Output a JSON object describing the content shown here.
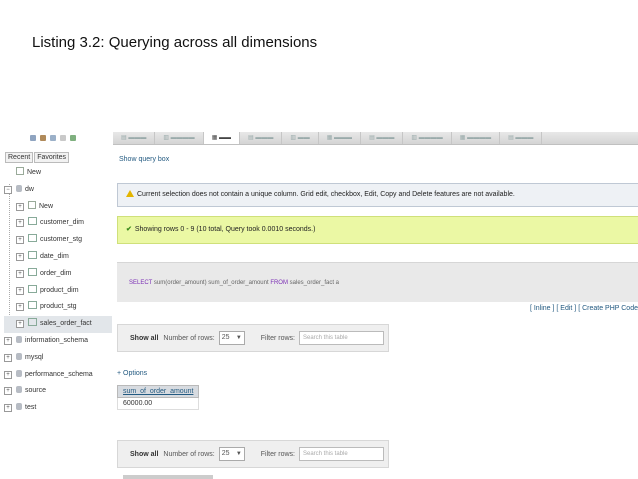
{
  "slide": {
    "title": "Listing 3.2: Querying across all dimensions"
  },
  "nav": {
    "tabs": [
      "Recent",
      "Favorites"
    ],
    "tree": [
      {
        "label": "New",
        "level": 0,
        "icon": "new-icon"
      },
      {
        "label": "dw",
        "level": 0,
        "icon": "database-icon"
      },
      {
        "label": "New",
        "level": 1,
        "icon": "new-icon"
      },
      {
        "label": "customer_dim",
        "level": 1,
        "icon": "table-icon"
      },
      {
        "label": "customer_stg",
        "level": 1,
        "icon": "table-icon"
      },
      {
        "label": "date_dim",
        "level": 1,
        "icon": "table-icon"
      },
      {
        "label": "order_dim",
        "level": 1,
        "icon": "table-icon"
      },
      {
        "label": "product_dim",
        "level": 1,
        "icon": "table-icon"
      },
      {
        "label": "product_stg",
        "level": 1,
        "icon": "table-icon"
      },
      {
        "label": "sales_order_fact",
        "level": 1,
        "icon": "table-icon",
        "selected": true
      },
      {
        "label": "information_schema",
        "level": 0,
        "icon": "database-icon"
      },
      {
        "label": "mysql",
        "level": 0,
        "icon": "database-icon"
      },
      {
        "label": "performance_schema",
        "level": 0,
        "icon": "database-icon"
      },
      {
        "label": "source",
        "level": 0,
        "icon": "database-icon"
      },
      {
        "label": "test",
        "level": 0,
        "icon": "database-icon"
      }
    ]
  },
  "main": {
    "show_query_box": "Show query box",
    "notice": "Current selection does not contain a unique column. Grid edit, checkbox, Edit, Copy and Delete features are not available.",
    "success": "Showing rows 0 - 9 (10 total, Query took 0.0010 seconds.)",
    "sql": {
      "select_kw": "SELECT",
      "select_expr": "sum(order_amount) sum_of_order_amount",
      "from_kw": "FROM",
      "from_expr": "sales_order_fact a"
    },
    "links": "[ Inline ] [ Edit ] [ Create PHP Code",
    "controls": {
      "show_all": "Show all",
      "rows_label": "Number of rows:",
      "rows_value": "25",
      "filter_label": "Filter rows:",
      "filter_placeholder": "Search this table"
    },
    "options_label": "+ Options",
    "result": {
      "header": "sum_of_order_amount",
      "values": [
        "60000.00"
      ]
    }
  }
}
